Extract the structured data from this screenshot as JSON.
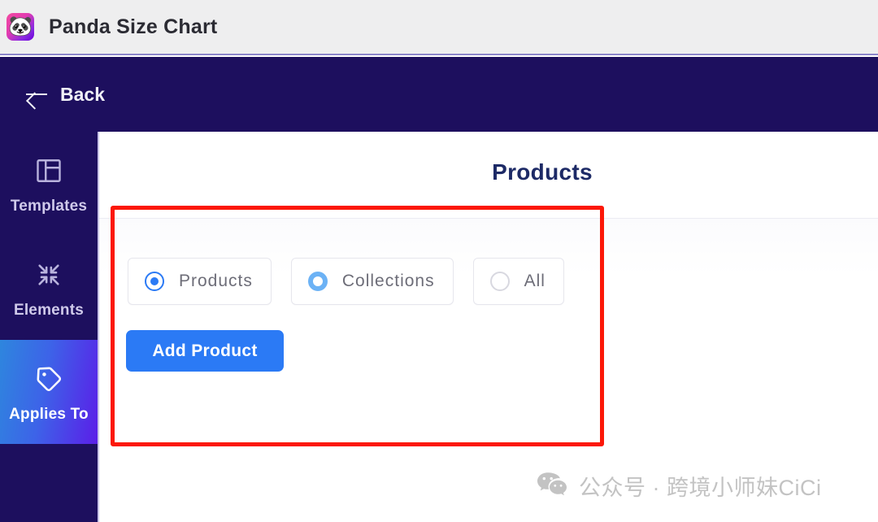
{
  "window": {
    "app_icon": "panda-icon",
    "app_icon_glyph": "🐼",
    "title": "Panda Size Chart",
    "titlebar_bg": "#eeeeef"
  },
  "navbar": {
    "back_label": "Back",
    "back_icon": "arrow-left-icon",
    "bg": "#1d0f5e"
  },
  "sidebar": {
    "bg": "#1d0f5e",
    "active_gradient_from": "#2e86de",
    "active_gradient_to": "#5b1ee8",
    "items": [
      {
        "label": "Templates",
        "icon": "layout-panel-icon",
        "active": false
      },
      {
        "label": "Elements",
        "icon": "collapse-arrows-icon",
        "active": false
      },
      {
        "label": "Applies To",
        "icon": "tag-icon",
        "active": true
      }
    ]
  },
  "main": {
    "title": "Products",
    "title_color": "#1d2a66",
    "applies_to": {
      "options": [
        {
          "label": "Products",
          "state": "selected",
          "radio_color": "#2b7af5"
        },
        {
          "label": "Collections",
          "state": "focus",
          "radio_color": "#6cb2f5"
        },
        {
          "label": "All",
          "state": "empty",
          "radio_color": "#d8d8e0"
        }
      ],
      "add_button_label": "Add Product",
      "add_button_color": "#2b7af5"
    }
  },
  "annotation": {
    "type": "highlight-rectangle",
    "color": "#fc1808"
  },
  "watermark": {
    "icon": "wechat-icon",
    "text": "公众号 · 跨境小师妹CiCi",
    "color": "#c3c3c3"
  }
}
